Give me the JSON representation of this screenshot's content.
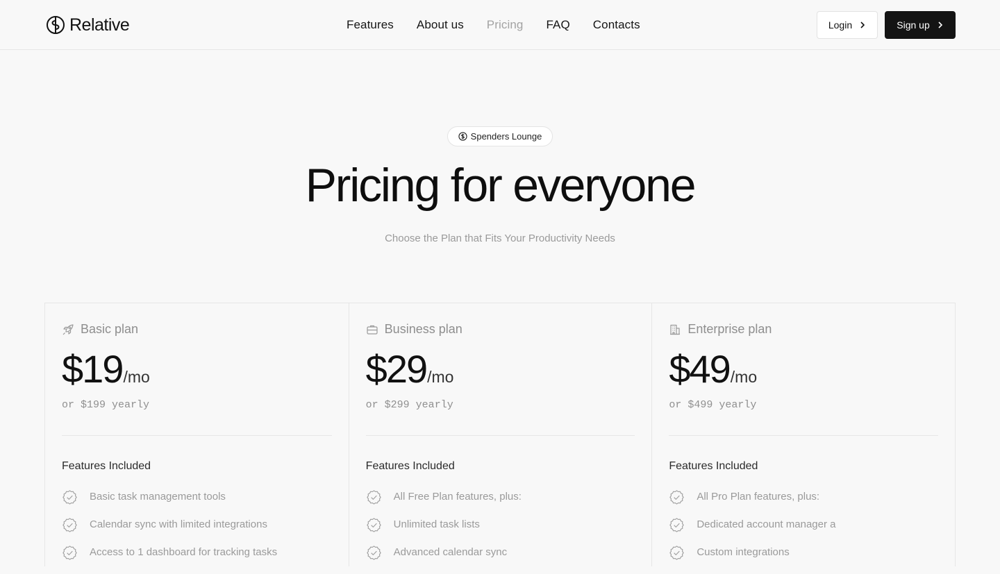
{
  "header": {
    "logo_text": "Relative",
    "nav": [
      {
        "label": "Features"
      },
      {
        "label": "About us"
      },
      {
        "label": "Pricing",
        "active": true
      },
      {
        "label": "FAQ"
      },
      {
        "label": "Contacts"
      }
    ],
    "login_label": "Login",
    "signup_label": "Sign up"
  },
  "hero": {
    "badge": "Spenders Lounge",
    "title": "Pricing for everyone",
    "subtitle": "Choose the Plan that Fits Your Productivity Needs"
  },
  "plans": [
    {
      "icon": "rocket-icon",
      "name": "Basic plan",
      "price": "$19",
      "period": "/mo",
      "yearly": "or $199 yearly",
      "features_title": "Features Included",
      "features": [
        "Basic task management tools",
        "Calendar sync with limited integrations",
        "Access to 1 dashboard for tracking tasks"
      ]
    },
    {
      "icon": "briefcase-icon",
      "name": "Business plan",
      "price": "$29",
      "period": "/mo",
      "yearly": "or $299 yearly",
      "features_title": "Features Included",
      "features": [
        "All Free Plan features, plus:",
        "Unlimited task lists",
        "Advanced calendar sync"
      ]
    },
    {
      "icon": "building-icon",
      "name": "Enterprise plan",
      "price": "$49",
      "period": "/mo",
      "yearly": "or $499 yearly",
      "features_title": "Features Included",
      "features": [
        "All Pro Plan features, plus:",
        "Dedicated account manager a",
        "Custom integrations"
      ]
    }
  ],
  "colors": {
    "background": "#f8f8f8",
    "primary_button": "#141414",
    "muted_text": "#9a9a9a",
    "border": "#e6e6e6"
  }
}
